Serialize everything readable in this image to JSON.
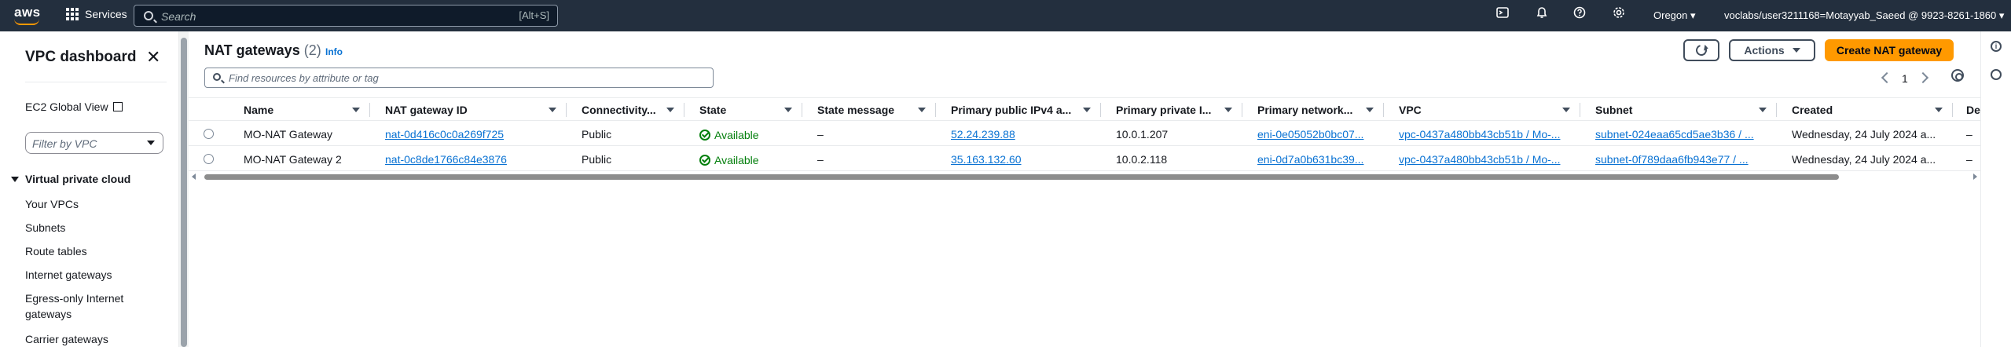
{
  "topnav": {
    "logo": "aws",
    "services": "Services",
    "search_placeholder": "Search",
    "search_shortcut": "[Alt+S]",
    "region": "Oregon",
    "account": "voclabs/user3211168=Motayyab_Saeed @ 9923-8261-1860"
  },
  "sidebar": {
    "title": "VPC dashboard",
    "ec2_global_view": "EC2 Global View",
    "filter_placeholder": "Filter by VPC",
    "section": "Virtual private cloud",
    "items": [
      "Your VPCs",
      "Subnets",
      "Route tables",
      "Internet gateways",
      "Egress-only Internet",
      "gateways",
      "Carrier gateways"
    ]
  },
  "main": {
    "title": "NAT gateways",
    "count": "(2)",
    "info": "Info",
    "actions": "Actions",
    "create": "Create NAT gateway",
    "search_placeholder": "Find resources by attribute or tag",
    "page": "1"
  },
  "table": {
    "columns": [
      "Name",
      "NAT gateway ID",
      "Connectivity...",
      "State",
      "State message",
      "Primary public IPv4 a...",
      "Primary private I...",
      "Primary network...",
      "VPC",
      "Subnet",
      "Created",
      "De"
    ],
    "rows": [
      {
        "name": "MO-NAT Gateway",
        "id": "nat-0d416c0c0a269f725",
        "connectivity": "Public",
        "state": "Available",
        "message": "–",
        "public_ip": "52.24.239.88",
        "private_ip": "10.0.1.207",
        "eni": "eni-0e05052b0bc07...",
        "vpc": "vpc-0437a480bb43cb51b / Mo-...",
        "subnet": "subnet-024eaa65cd5ae3b36 / ...",
        "created": "Wednesday, 24 July 2024 a...",
        "del": "–"
      },
      {
        "name": "MO-NAT Gateway 2",
        "id": "nat-0c8de1766c84e3876",
        "connectivity": "Public",
        "state": "Available",
        "message": "–",
        "public_ip": "35.163.132.60",
        "private_ip": "10.0.2.118",
        "eni": "eni-0d7a0b631bc39...",
        "vpc": "vpc-0437a480bb43cb51b / Mo-...",
        "subnet": "subnet-0f789daa6fb943e77 / ...",
        "created": "Wednesday, 24 July 2024 a...",
        "del": "–"
      }
    ]
  },
  "colors": {
    "nav_bg": "#232f3e",
    "primary_button": "#ff9900",
    "link": "#0972d3",
    "success": "#037f0c"
  }
}
